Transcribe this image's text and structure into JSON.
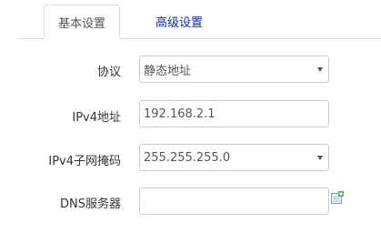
{
  "tabs": {
    "basic_label": "基本设置",
    "advanced_label": "高级设置",
    "active": "basic"
  },
  "form": {
    "protocol": {
      "label": "协议",
      "selected": "静态地址"
    },
    "ipv4_address": {
      "label": "IPv4地址",
      "value": "192.168.2.1"
    },
    "ipv4_netmask": {
      "label": "IPv4子网掩码",
      "selected": "255.255.255.0"
    },
    "dns_servers": {
      "label": "DNS服务器",
      "value": ""
    }
  },
  "icons": {
    "dropdown": "chevron-down-icon",
    "add_dns": "add-entry-icon"
  },
  "colors": {
    "active_tab_text": "#555555",
    "inactive_tab_text": "#0a2ea4",
    "field_border": "#cccccc",
    "add_icon_green": "#4caf50"
  }
}
